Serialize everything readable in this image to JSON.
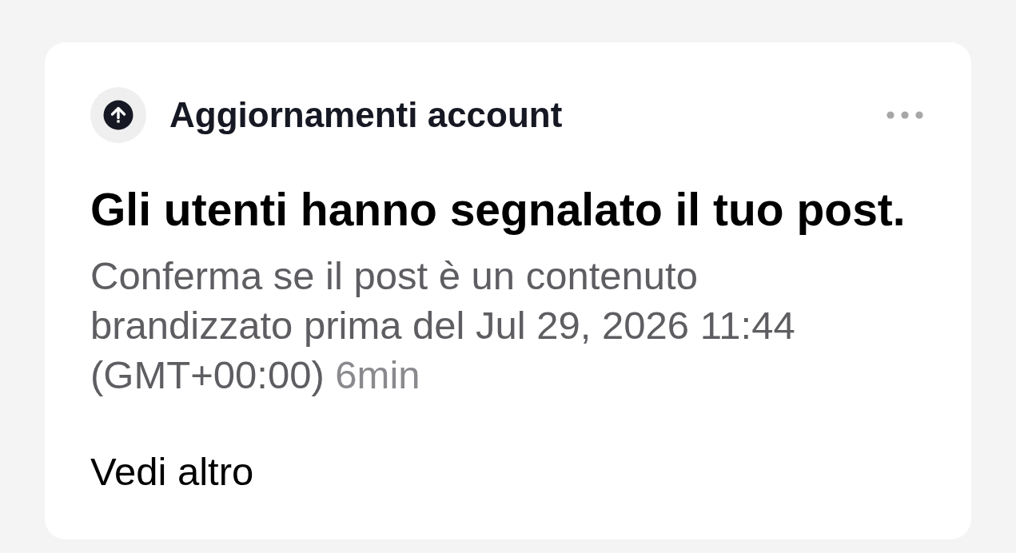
{
  "notification": {
    "category": "Aggiornamenti account",
    "title": "Gli utenti hanno segnalato il tuo post.",
    "message": "Conferma se il post è un contenuto brandizzato prima del Jul 29, 2026 11:44 (GMT+00:00)",
    "time": "6min",
    "link": "Vedi altro"
  }
}
